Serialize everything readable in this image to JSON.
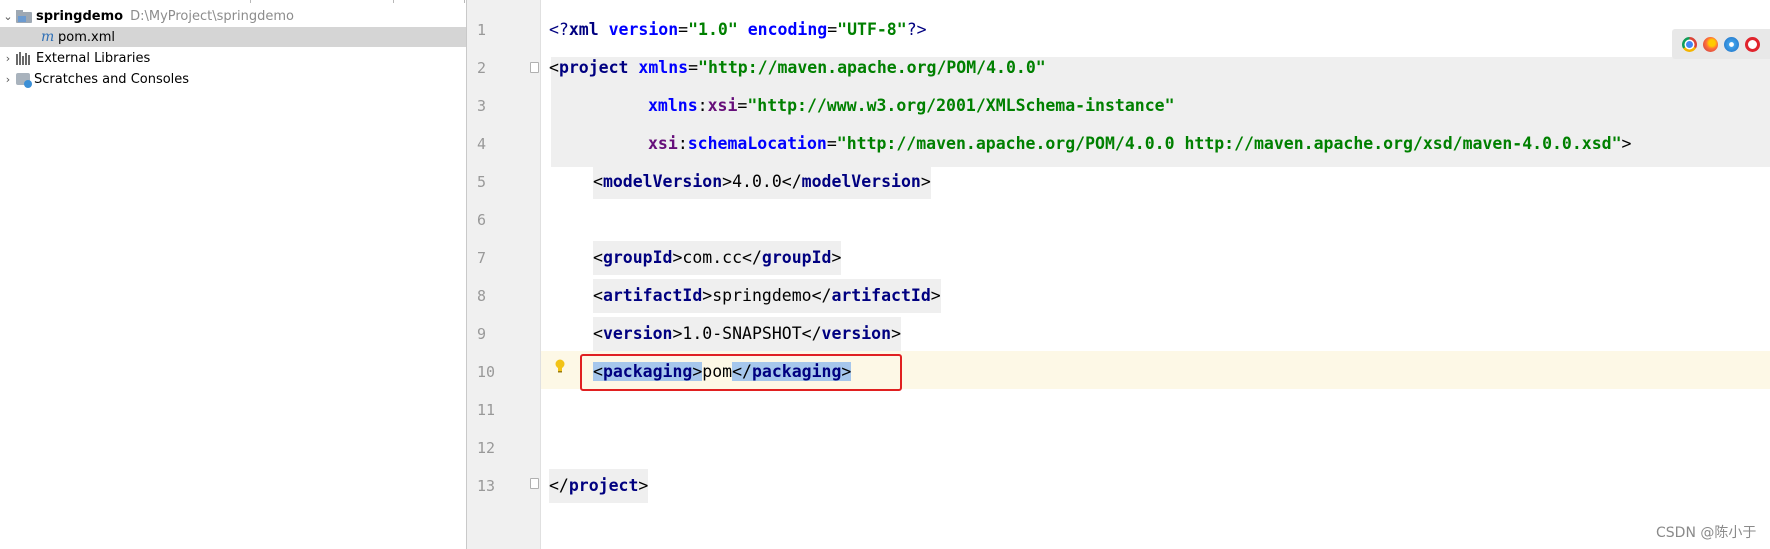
{
  "project_tree": {
    "items": [
      {
        "label": "springdemo",
        "path": "D:\\MyProject\\springdemo",
        "icon": "module-folder-icon",
        "expanded": true
      },
      {
        "label": "pom.xml",
        "icon": "maven-file-icon",
        "selected": true
      },
      {
        "label": "External Libraries",
        "icon": "libraries-icon",
        "expanded": false
      },
      {
        "label": "Scratches and Consoles",
        "icon": "scratches-icon",
        "expanded": false
      }
    ]
  },
  "editor": {
    "line_numbers": [
      "1",
      "2",
      "3",
      "4",
      "5",
      "6",
      "7",
      "8",
      "9",
      "10",
      "11",
      "12",
      "13"
    ],
    "current_line": 10,
    "code": {
      "l1_pi_open": "<?",
      "l1_xml": "xml",
      "l1_version_attr": "version",
      "l1_eq": "=",
      "l1_version_val": "\"1.0\"",
      "l1_encoding_attr": "encoding",
      "l1_encoding_val": "\"UTF-8\"",
      "l1_pi_close": "?>",
      "l2_open": "<",
      "l2_tag": "project",
      "l2_attr": "xmlns",
      "l2_val": "\"http://maven.apache.org/POM/4.0.0\"",
      "l3_ns": "xmlns",
      "l3_colon": ":",
      "l3_attr": "xsi",
      "l3_val": "\"http://www.w3.org/2001/XMLSchema-instance\"",
      "l4_ns": "xsi",
      "l4_attr": "schemaLocation",
      "l4_val": "\"http://maven.apache.org/POM/4.0.0 http://maven.apache.org/xsd/maven-4.0.0.xsd\"",
      "l4_close": ">",
      "modelVersion_tag": "modelVersion",
      "modelVersion_val": "4.0.0",
      "groupId_tag": "groupId",
      "groupId_val": "com.cc",
      "artifactId_tag": "artifactId",
      "artifactId_val": "springdemo",
      "version_tag": "version",
      "version_val": "1.0-SNAPSHOT",
      "packaging_tag": "packaging",
      "packaging_val": "pom",
      "project_close_tag": "project"
    }
  },
  "browser_icons": [
    "chrome-icon",
    "firefox-icon",
    "safari-icon",
    "opera-icon"
  ],
  "watermark": "CSDN @陈小于",
  "colors": {
    "xml_tag": "#000080",
    "xml_attr": "#0000ff",
    "xml_namespace": "#660e7a",
    "xml_string": "#008000",
    "selection": "#a6c7ec",
    "current_line": "#fdf8e6",
    "annotation_box": "#e02020"
  }
}
